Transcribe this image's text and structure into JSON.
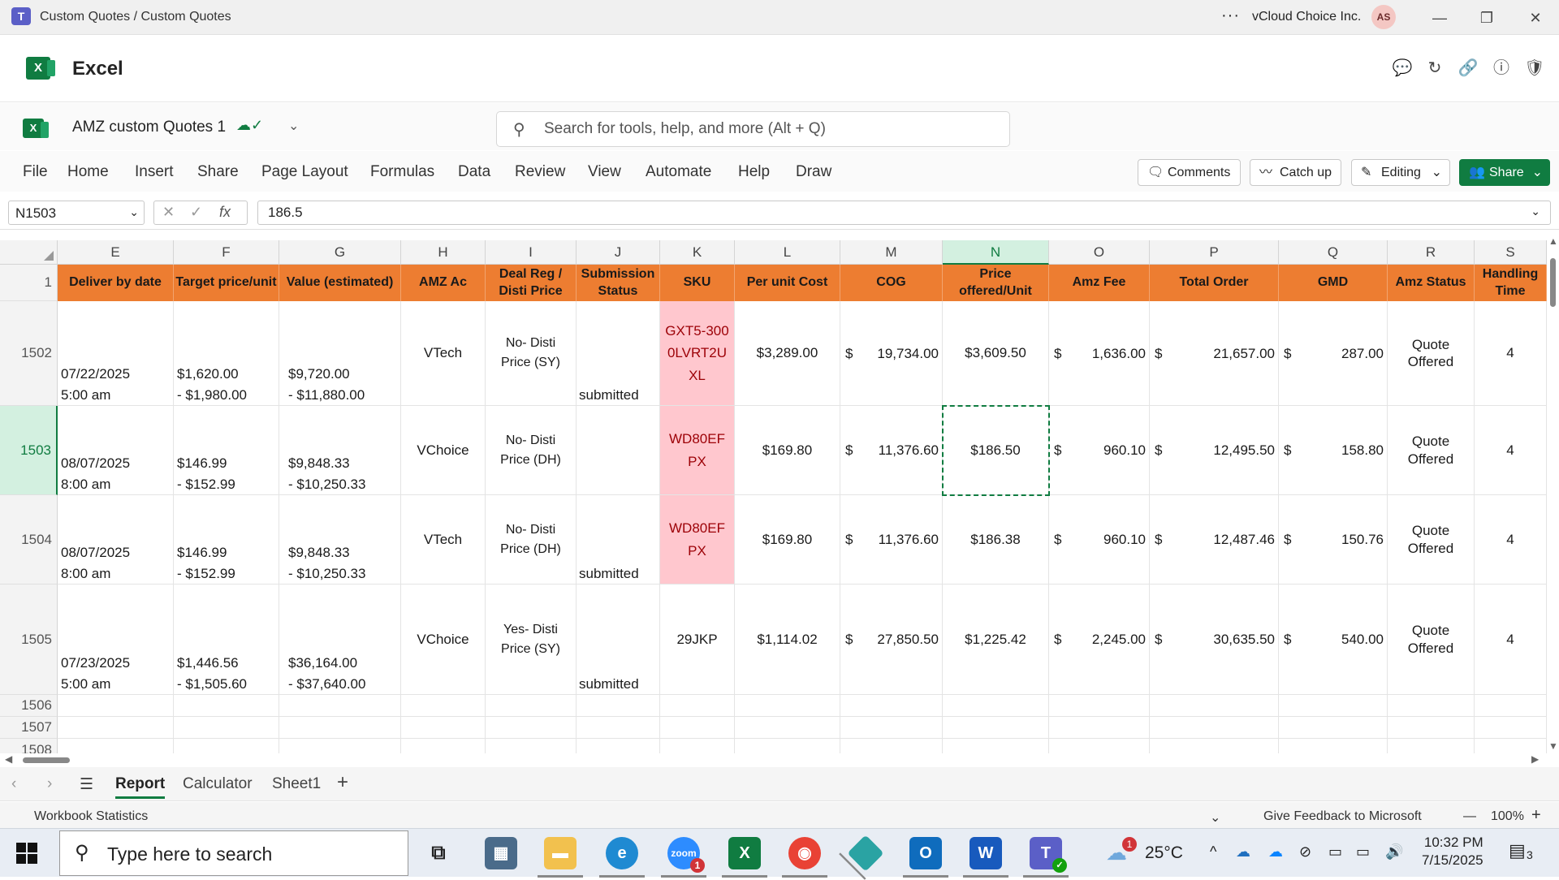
{
  "window": {
    "title": "Custom Quotes / Custom Quotes",
    "org": "vCloud Choice Inc.",
    "avatar_initials": "AS"
  },
  "app": {
    "name": "Excel",
    "doc_name": "AMZ custom Quotes 1",
    "search_placeholder": "Search for tools, help, and more (Alt + Q)"
  },
  "ribbon": {
    "tabs": [
      "File",
      "Home",
      "Insert",
      "Share",
      "Page Layout",
      "Formulas",
      "Data",
      "Review",
      "View",
      "Automate",
      "Help",
      "Draw"
    ],
    "comments": "Comments",
    "catch_up": "Catch up",
    "editing": "Editing",
    "share": "Share"
  },
  "formula_bar": {
    "name_box": "N1503",
    "value": "186.5",
    "fx": "fx"
  },
  "grid": {
    "columns": [
      "E",
      "F",
      "G",
      "H",
      "I",
      "J",
      "K",
      "L",
      "M",
      "N",
      "O",
      "P",
      "Q",
      "R",
      "S"
    ],
    "selected_column": "N",
    "header_row_number": "1",
    "headers": {
      "E": "Deliver by date",
      "F": "Target price/unit",
      "G": "Value (estimated)",
      "H": "AMZ Ac",
      "I": "Deal Reg / Disti Price",
      "J": "Submission Status",
      "K": "SKU",
      "L": "Per unit Cost",
      "M": "COG",
      "N": "Price offered/Unit",
      "O": "Amz Fee",
      "P": "Total Order",
      "Q": "GMD",
      "R": "Amz Status",
      "S": "Handling Time"
    },
    "rows": [
      {
        "num": "1502",
        "date": "07/22/2025",
        "time": "5:00 am",
        "target1": "$1,620.00",
        "target2": "- $1,980.00",
        "value1": "$9,720.00",
        "value2": "- $11,880.00",
        "amz_ac": "VTech",
        "deal_reg": "No- Disti Price (SY)",
        "status": "submitted",
        "sku": "GXT5-3000LVRT2UXL",
        "unit_cost": "$3,289.00",
        "cog": "19,734.00",
        "price": "$3,609.50",
        "fee": "1,636.00",
        "total": "21,657.00",
        "gmd": "287.00",
        "amz_status": "Quote Offered",
        "handling": "4"
      },
      {
        "num": "1503",
        "date": "08/07/2025",
        "time": "8:00 am",
        "target1": "$146.99",
        "target2": "- $152.99",
        "value1": "$9,848.33",
        "value2": "- $10,250.33",
        "amz_ac": "VChoice",
        "deal_reg": "No- Disti Price (DH)",
        "status": "",
        "sku": "WD80EFPX",
        "unit_cost": "$169.80",
        "cog": "11,376.60",
        "price": "$186.50",
        "fee": "960.10",
        "total": "12,495.50",
        "gmd": "158.80",
        "amz_status": "Quote Offered",
        "handling": "4"
      },
      {
        "num": "1504",
        "date": "08/07/2025",
        "time": "8:00 am",
        "target1": "$146.99",
        "target2": "- $152.99",
        "value1": "$9,848.33",
        "value2": "- $10,250.33",
        "amz_ac": "VTech",
        "deal_reg": "No- Disti Price (DH)",
        "status": "submitted",
        "sku": "WD80EFPX",
        "unit_cost": "$169.80",
        "cog": "11,376.60",
        "price": "$186.38",
        "fee": "960.10",
        "total": "12,487.46",
        "gmd": "150.76",
        "amz_status": "Quote Offered",
        "handling": "4"
      },
      {
        "num": "1505",
        "date": "07/23/2025",
        "time": "5:00 am",
        "target1": "$1,446.56",
        "target2": "- $1,505.60",
        "value1": "$36,164.00",
        "value2": "- $37,640.00",
        "amz_ac": "VChoice",
        "deal_reg": "Yes- Disti Price (SY)",
        "status": "submitted",
        "sku": "29JKP",
        "unit_cost": "$1,114.02",
        "cog": "27,850.50",
        "price": "$1,225.42",
        "fee": "2,245.00",
        "total": "30,635.50",
        "gmd": "540.00",
        "amz_status": "Quote Offered",
        "handling": "4"
      }
    ],
    "empty_rows": [
      "1506",
      "1507",
      "1508"
    ],
    "currency_symbol": "$"
  },
  "sheets": {
    "tabs": [
      "Report",
      "Calculator",
      "Sheet1"
    ],
    "active": "Report"
  },
  "status_bar": {
    "left": "Workbook Statistics",
    "feedback": "Give Feedback to Microsoft",
    "zoom": "100%"
  },
  "taskbar": {
    "search_placeholder": "Type here to search",
    "weather": "25°C",
    "weather_badge": "1",
    "zoom_badge": "1",
    "time": "10:32 PM",
    "date": "7/15/2025",
    "notifications": "3"
  },
  "colors": {
    "header_orange": "#ed7d31",
    "excel_green": "#107c41",
    "sku_pink": "#ffc7ce",
    "sku_text": "#9c0006"
  }
}
